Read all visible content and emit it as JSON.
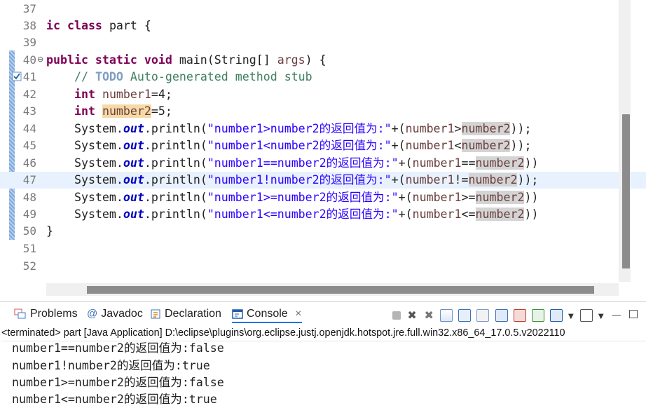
{
  "editor": {
    "lines": [
      {
        "no": "37"
      },
      {
        "no": "38",
        "class_kw": "ic class",
        "class_name": "part",
        "brace": "{"
      },
      {
        "no": "39"
      },
      {
        "no": "40",
        "kw": "public static void",
        "sig": "main(String[] ",
        "param": "args",
        ",close": ") {"
      },
      {
        "no": "41",
        "comment_pre": "// ",
        "todo": "TODO",
        "comment_post": " Auto-generated method stub"
      },
      {
        "no": "42",
        "type": "int",
        "var": "number1",
        "rest": "=4;"
      },
      {
        "no": "43",
        "type": "int",
        "var": "number2",
        "rest": "=5;"
      },
      {
        "no": "44",
        "str": "\"number1>number2的返回值为:\"",
        "v1": "number1",
        "op": ">",
        "v2": "number2",
        "end": "));"
      },
      {
        "no": "45",
        "str": "\"number1<number2的返回值为:\"",
        "v1": "number1",
        "op": "<",
        "v2": "number2",
        "end": "));"
      },
      {
        "no": "46",
        "str": "\"number1==number2的返回值为:\"",
        "v1": "number1",
        "op": "==",
        "v2": "number2",
        "end": "))"
      },
      {
        "no": "47",
        "str": "\"number1!number2的返回值为:\"",
        "v1": "number1",
        "op": "!=",
        "v2": "number2",
        "end": "));"
      },
      {
        "no": "48",
        "str": "\"number1>=number2的返回值为:\"",
        "v1": "number1",
        "op": ">=",
        "v2": "number2",
        "end": "))"
      },
      {
        "no": "49",
        "str": "\"number1<=number2的返回值为:\"",
        "v1": "number1",
        "op": "<=",
        "v2": "number2",
        "end": "))"
      },
      {
        "no": "50",
        "brace": "}"
      },
      {
        "no": "51"
      },
      {
        "no": "52"
      }
    ],
    "call_prefix": "System.",
    "call_field": "out",
    "call_method": ".println(",
    "call_plus": "+(",
    "colors": {
      "keyword": "#7f0055",
      "string": "#2a00ff",
      "comment": "#3f7f5f",
      "field": "#0000c0",
      "current_line": "#e8f2fe"
    }
  },
  "panel": {
    "tabs": [
      {
        "label": "Problems",
        "icon": "problems-icon"
      },
      {
        "label": "Javadoc",
        "icon": "at-icon"
      },
      {
        "label": "Declaration",
        "icon": "declaration-icon"
      },
      {
        "label": "Console",
        "icon": "console-icon",
        "active": true
      }
    ],
    "close_glyph": "×",
    "status": "<terminated> part [Java Application] D:\\eclipse\\plugins\\org.eclipse.justj.openjdk.hotspot.jre.full.win32.x86_64_17.0.5.v2022110",
    "output": [
      "number1==number2的返回值为:false",
      "number1!number2的返回值为:true",
      "number1>=number2的返回值为:false",
      "number1<=number2的返回值为:true"
    ]
  }
}
